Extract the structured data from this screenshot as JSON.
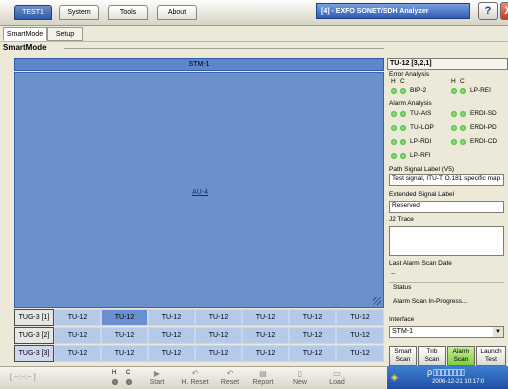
{
  "top_tabs": [
    "TEST1",
    "System",
    "Tools",
    "About"
  ],
  "app_title": "[4] - EXFO  SONET/SDH Analyzer",
  "help_label": "?",
  "close_label": "X",
  "sub_tabs": [
    "SmartMode",
    "Setup"
  ],
  "section_title": "SmartMode",
  "stm_label": "STM-1",
  "au_label": "AU-4",
  "tug_rows": [
    {
      "label": "TUG-3 [1]",
      "cells": [
        "TU-12",
        "TU-12",
        "TU-12",
        "TU-12",
        "TU-12",
        "TU-12",
        "TU-12"
      ]
    },
    {
      "label": "TUG-3 [2]",
      "cells": [
        "TU-12",
        "TU-12",
        "TU-12",
        "TU-12",
        "TU-12",
        "TU-12",
        "TU-12"
      ]
    },
    {
      "label": "TUG-3 [3]",
      "cells": [
        "TU-12",
        "TU-12",
        "TU-12",
        "TU-12",
        "TU-12",
        "TU-12",
        "TU-12"
      ]
    }
  ],
  "bottom": {
    "time": "[ --:--:-- ]",
    "h": "H",
    "c": "C",
    "buttons": [
      "Start",
      "H. Reset",
      "Reset",
      "Report",
      "New",
      "Load"
    ]
  },
  "right_panel": {
    "title": "TU-12 [3,2,1]",
    "error_analysis": "Error Analysis",
    "h": "H",
    "c": "C",
    "bip2": "BIP-2",
    "lp_rei": "LP-REI",
    "alarm_analysis": "Alarm Analysis",
    "alarms": [
      "TU-AIS",
      "ERDI-SD",
      "TU-LOP",
      "ERDI-PD",
      "LP-RDI",
      "ERDI-CD",
      "LP-RFI"
    ],
    "path_signal_label": "Path Signal Label (V5)",
    "path_signal_value": "Test signal, ITU-T O.181 specific map",
    "extended_label": "Extended Signal Label",
    "extended_value": "Reserved",
    "j2_label": "J2 Trace",
    "last_scan_label": "Last Alarm Scan Date",
    "last_scan_value": "--",
    "status_label": "Status",
    "status_value": "Alarm Scan In-Progress...",
    "interface_label": "Interface",
    "interface_value": "STM-1",
    "action_buttons": [
      [
        "Smart",
        "Scan"
      ],
      [
        "Trib",
        "Scan"
      ],
      [
        "Alarm",
        "Scan"
      ],
      [
        "Launch",
        "Test"
      ]
    ]
  },
  "tray": {
    "status": "ρ ▯▯▯▯▯▯▯▯",
    "date": "2006-12-21 10:17:0"
  }
}
